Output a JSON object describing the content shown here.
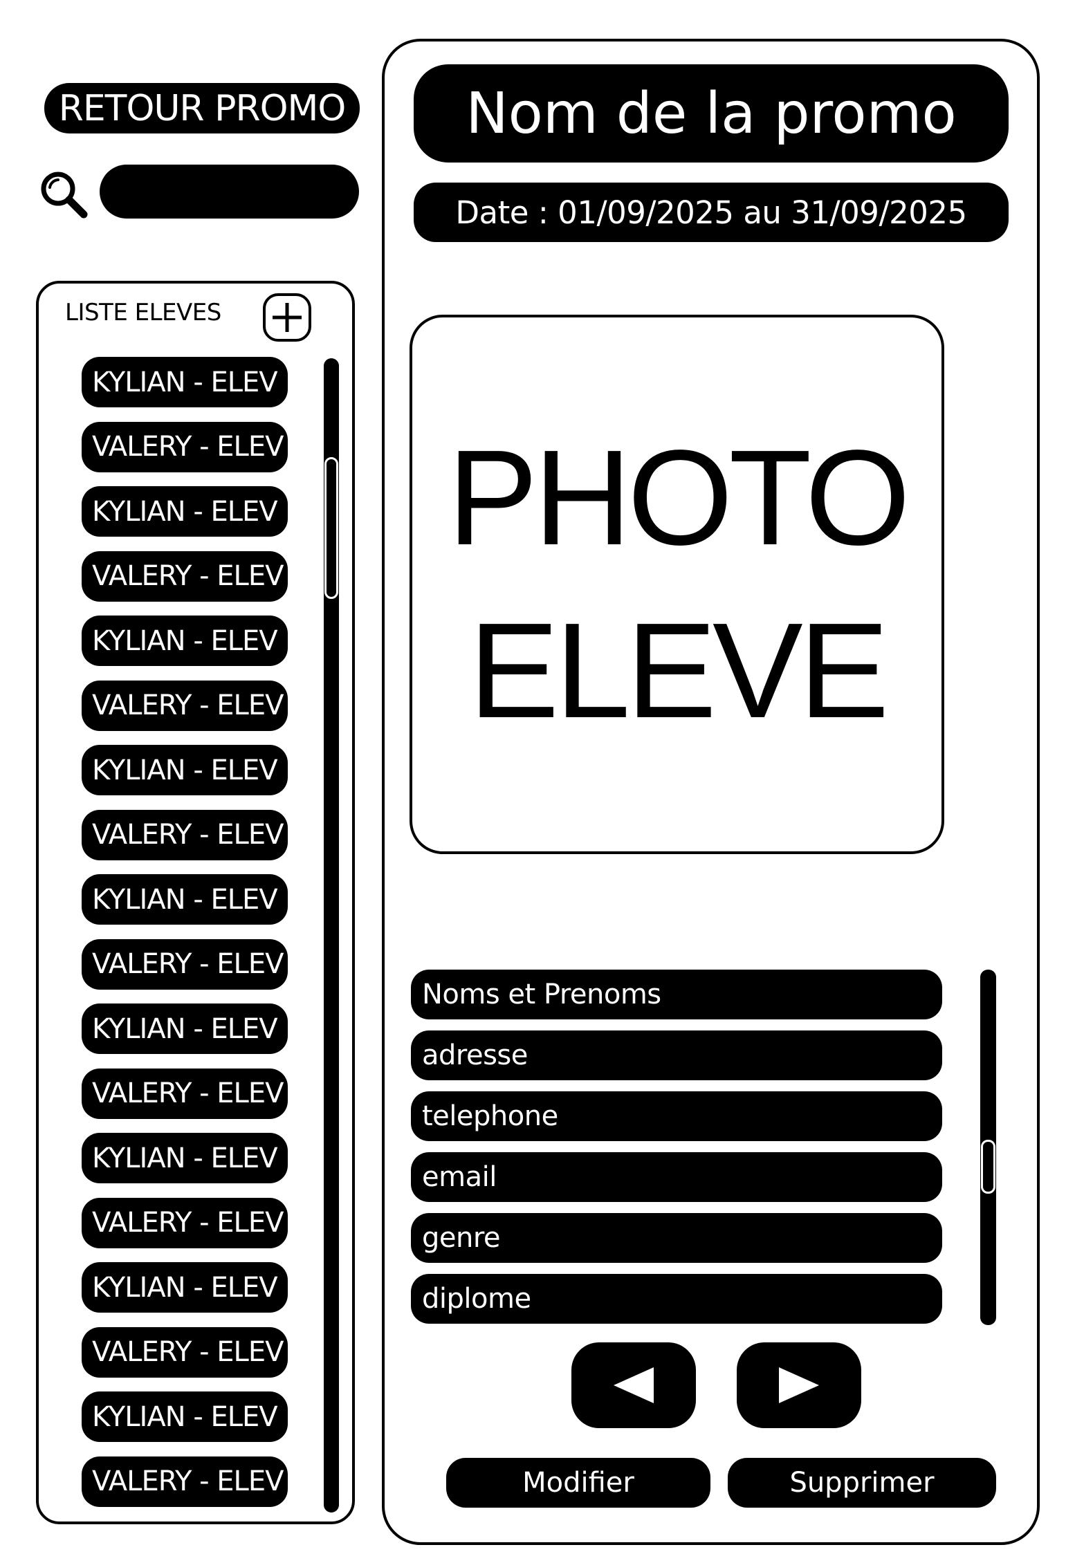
{
  "header": {
    "back_label": "RETOUR PROMO",
    "search_value": ""
  },
  "students": {
    "title": "LISTE ELEVES",
    "add_icon": "plus-icon",
    "items": [
      "KYLIAN - ELEV",
      "VALERY - ELEV",
      "KYLIAN - ELEV",
      "VALERY - ELEV",
      "KYLIAN - ELEV",
      "VALERY - ELEV",
      "KYLIAN - ELEV",
      "VALERY - ELEV",
      "KYLIAN - ELEV",
      "VALERY - ELEV",
      "KYLIAN - ELEV",
      "VALERY - ELEV",
      "KYLIAN - ELEV",
      "VALERY - ELEV",
      "KYLIAN - ELEV",
      "VALERY - ELEV",
      "KYLIAN - ELEV",
      "VALERY - ELEV"
    ]
  },
  "promo": {
    "name": "Nom de la promo",
    "date": "Date : 01/09/2025 au 31/09/2025"
  },
  "photo": {
    "line1": "PHOTO",
    "line2": "ELEVE"
  },
  "fields": [
    "Noms et Prenoms",
    "adresse",
    "telephone",
    "email",
    "genre",
    "diplome"
  ],
  "navigation": {
    "prev_icon": "triangle-left-icon",
    "next_icon": "triangle-right-icon"
  },
  "actions": {
    "modify_label": "Modifier",
    "delete_label": "Supprimer"
  },
  "colors": {
    "foreground": "#000000",
    "background": "#ffffff",
    "text_on_dark": "#ffffff"
  }
}
